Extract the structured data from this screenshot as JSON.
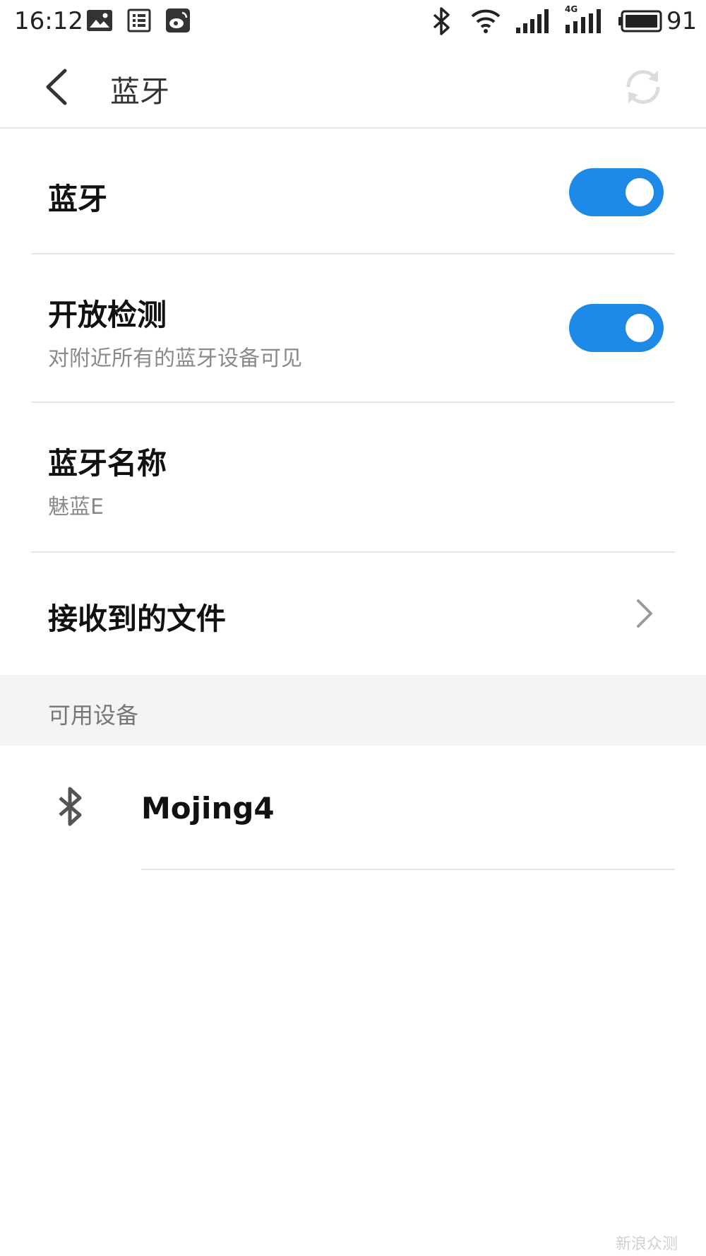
{
  "status_bar": {
    "time": "16:12",
    "battery_level": "91",
    "network_label": "4G",
    "icons": [
      "gallery-icon",
      "notes-icon",
      "weibo-icon",
      "bluetooth-icon",
      "wifi-icon",
      "signal-icon",
      "signal-4g-icon",
      "battery-icon"
    ]
  },
  "header": {
    "title": "蓝牙",
    "back_icon": "back-arrow-icon",
    "refresh_icon": "refresh-icon"
  },
  "settings": {
    "bluetooth": {
      "title": "蓝牙",
      "enabled": true
    },
    "discoverable": {
      "title": "开放检测",
      "subtitle": "对附近所有的蓝牙设备可见",
      "enabled": true
    },
    "device_name": {
      "title": "蓝牙名称",
      "value": "魅蓝E"
    },
    "received_files": {
      "title": "接收到的文件"
    }
  },
  "available_devices": {
    "section_title": "可用设备",
    "devices": [
      {
        "name": "Mojing4",
        "icon": "bluetooth-icon"
      }
    ]
  },
  "watermark": "新浪众测",
  "colors": {
    "accent": "#1e8ae8",
    "divider": "#e6e6e6",
    "section_bg": "#f4f4f4",
    "subtitle": "#8a8a8a"
  }
}
